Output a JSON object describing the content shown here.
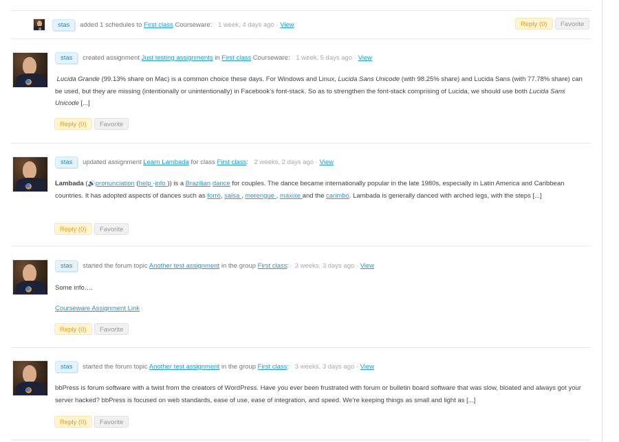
{
  "colors": {
    "link": "#1e9ad6",
    "badge_bg": "#e7f3fc",
    "reply_bg": "#fff4d4",
    "reply_text": "#e89b10",
    "favorite_bg": "#f1f1f1"
  },
  "activities": [
    {
      "user": "stas",
      "action": "added 1 schedules to",
      "link1": "First class",
      "suffix": "Courseware:",
      "time": "1 week, 4 days ago",
      "sep": "·",
      "view": "View",
      "reply": "Reply (0)",
      "favorite": "Favorite"
    },
    {
      "user": "stas",
      "action": "created assignment",
      "link1": "Just testing assignments",
      "mid": "in",
      "link2": "First class",
      "suffix": "Courseware:",
      "time": "1 week, 5 days ago",
      "sep": "·",
      "view": "View",
      "body": {
        "p1_italic": "Lucida Grande",
        "p2": " (99.13% share on Mac) is a common choice these days. For Windows and Linux, ",
        "p3_italic": "Lucida Sans Unicode",
        "p4": " (with 98.25% share) and Lucida Sans (with 77.78% share) can be used, but they are missing (intentionally or unintentionally) in Facebook’s font-stack. So as to strengthen the font-stack comprising of Lucida, we should use both ",
        "p5_italic": "Lucida Sans Unicode",
        "p6": " [...]"
      },
      "reply": "Reply (0)",
      "favorite": "Favorite"
    },
    {
      "user": "stas",
      "action": "updated assignment",
      "link1": "Learn Lambada",
      "mid": "for class",
      "link2": "First class",
      "suffix": ":",
      "time": "2 weeks, 2 days ago",
      "sep": "·",
      "view": "View",
      "body": {
        "bold": "Lambada",
        "t1": " (",
        "speaker_icon": "🔊",
        "l_pronunciation": "pronunciation",
        "t2": " (",
        "l_help": "help ",
        "t3": "·",
        "l_info": "info ",
        "t4": ")) is a  ",
        "l_brazilian": "Brazilian",
        "t5": " ",
        "l_dance": "dance",
        "t6": " for couples. The dance became internationally popular in the late 1980s, especially in Latin America and Caribbean countries. It has adopted aspects of dances such as  ",
        "l_forro": "forró",
        "t7": ", ",
        "l_salsa": "salsa ",
        "t8": ", ",
        "l_merengue": "merengue ",
        "t9": ", ",
        "l_maxixe": "maxixe ",
        "t10": "and the  ",
        "l_carimbo": "carimbó",
        "t11": ". Lambada is generally danced with arched legs, with the steps [...]"
      },
      "reply": "Reply (0)",
      "favorite": "Favorite"
    },
    {
      "user": "stas",
      "action": "started the forum topic",
      "link1": "Another test assignment",
      "mid": "in the group",
      "link2": "First class",
      "suffix": ":",
      "time": "3 weeks, 3 days ago",
      "sep": "·",
      "view": "View",
      "body": {
        "text": "Some info….",
        "link": "Courseware Assignment Link"
      },
      "reply": "Reply (0)",
      "favorite": "Favorite"
    },
    {
      "user": "stas",
      "action": "started the forum topic",
      "link1": "Another test assignment",
      "mid": "in the group",
      "link2": "First class",
      "suffix": ":",
      "time": "3 weeks, 3 days ago",
      "sep": "·",
      "view": "View",
      "body": {
        "text": "bbPress is forum software with a twist from the creators of WordPress. Have you ever been frustrated with forum or bulletin board software that was slow, bloated and always got your server hacked? bbPress is focused on web standards, ease of use, ease of integration, and speed. We’re keeping things as small and light as [...]"
      },
      "reply": "Reply (0)",
      "favorite": "Favorite"
    }
  ]
}
